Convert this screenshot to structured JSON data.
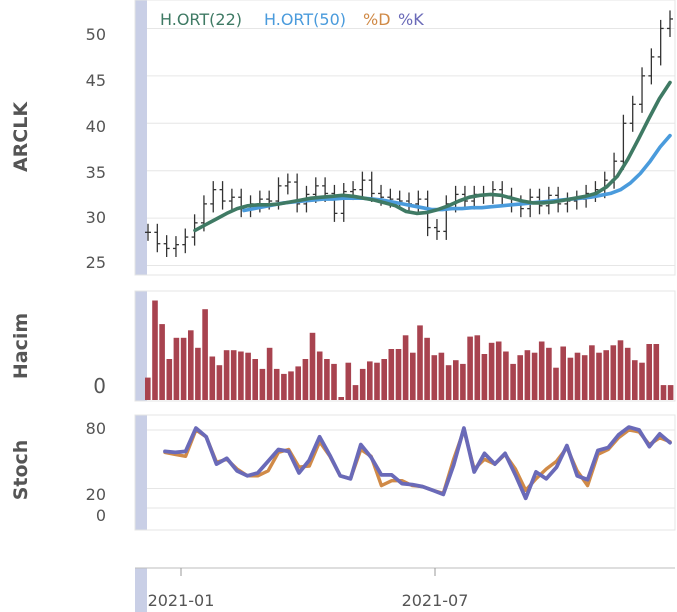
{
  "legend": {
    "ma22": {
      "label": "H.ORT(22)",
      "color": "#3f7a64"
    },
    "ma50": {
      "label": "H.ORT(50)",
      "color": "#4a9bdc"
    },
    "d": {
      "label": "%D",
      "color": "#d08a47"
    },
    "k": {
      "label": "%K",
      "color": "#6a6ab8"
    }
  },
  "chart_data": [
    {
      "type": "line",
      "panel": "price",
      "ylabel": "ARCLK",
      "ylim": [
        24,
        53
      ],
      "yticks": [
        25,
        30,
        35,
        40,
        45,
        50
      ],
      "grid": true,
      "legend_position": "top-left",
      "x_ticks": [
        "2021-01",
        "2021-07"
      ],
      "price_week_close": [
        28.5,
        27.3,
        26.8,
        27.2,
        28.0,
        29.5,
        31.5,
        33.0,
        31.8,
        32.2,
        31.0,
        31.5,
        32.0,
        31.8,
        33.4,
        33.8,
        31.5,
        32.5,
        33.4,
        32.6,
        30.5,
        32.8,
        33.0,
        34.0,
        32.6,
        32.2,
        32.0,
        31.8,
        31.5,
        32.0,
        29.0,
        28.6,
        31.5,
        32.5,
        31.8,
        32.5,
        32.4,
        33.0,
        32.3,
        31.5,
        31.0,
        32.2,
        31.3,
        32.4,
        31.5,
        31.8,
        32.0,
        32.6,
        33.0,
        34.0,
        36.0,
        40.0,
        42.0,
        45.0,
        47.0,
        50.0,
        51.0
      ],
      "series": [
        {
          "name": "H.ORT(22)",
          "values": [
            28.7,
            29.3,
            29.9,
            30.5,
            31.0,
            31.3,
            31.4,
            31.4,
            31.5,
            31.7,
            31.9,
            32.1,
            32.2,
            32.3,
            32.4,
            32.3,
            32.1,
            31.9,
            31.6,
            31.3,
            30.7,
            30.5,
            30.6,
            30.9,
            31.3,
            31.8,
            32.2,
            32.4,
            32.5,
            32.4,
            32.1,
            31.8,
            31.6,
            31.6,
            31.7,
            31.9,
            32.1,
            32.3,
            32.6,
            33.3,
            34.4,
            36.2,
            38.3,
            40.5,
            42.6,
            44.3
          ]
        },
        {
          "name": "H.ORT(50)",
          "values": [
            30.8,
            31.0,
            31.2,
            31.4,
            31.6,
            31.7,
            31.8,
            31.9,
            32.0,
            32.0,
            32.1,
            32.1,
            32.1,
            32.0,
            31.9,
            31.7,
            31.5,
            31.3,
            31.1,
            30.9,
            30.9,
            31.0,
            31.0,
            31.1,
            31.1,
            31.2,
            31.3,
            31.4,
            31.5,
            31.6,
            31.7,
            31.8,
            31.9,
            32.0,
            32.1,
            32.2,
            32.4,
            32.6,
            33.0,
            33.7,
            34.7,
            36.0,
            37.5,
            38.7
          ]
        }
      ]
    },
    {
      "type": "bar",
      "panel": "volume",
      "ylabel": "Hacim",
      "yticks": [
        0
      ],
      "values": [
        18,
        80,
        61,
        33,
        50,
        50,
        56,
        42,
        73,
        35,
        28,
        40,
        40,
        39,
        38,
        33,
        25,
        42,
        25,
        21,
        23,
        27,
        33,
        54,
        39,
        33,
        29,
        0,
        30,
        12,
        25,
        31,
        30,
        33,
        41,
        41,
        52,
        38,
        60,
        50,
        36,
        38,
        28,
        32,
        29,
        51,
        52,
        37,
        46,
        47,
        39,
        29,
        36,
        40,
        38,
        47,
        42,
        26,
        43,
        34,
        38,
        36,
        44,
        38,
        40,
        44,
        48,
        42,
        32,
        30,
        45,
        45,
        12,
        12
      ]
    },
    {
      "type": "line",
      "panel": "stochastic",
      "ylabel": "Stoch",
      "ylim": [
        -10,
        95
      ],
      "yticks": [
        0,
        20,
        80
      ],
      "series": [
        {
          "name": "%D",
          "values": [
            57,
            55,
            53,
            80,
            73,
            47,
            50,
            40,
            33,
            33,
            38,
            57,
            60,
            42,
            43,
            68,
            53,
            33,
            30,
            60,
            53,
            23,
            28,
            28,
            23,
            22,
            18,
            15,
            50,
            80,
            40,
            50,
            45,
            55,
            40,
            18,
            30,
            40,
            48,
            62,
            38,
            23,
            55,
            60,
            72,
            80,
            78,
            65,
            72,
            68
          ]
        },
        {
          "name": "%K",
          "values": [
            58,
            57,
            58,
            82,
            73,
            45,
            51,
            38,
            33,
            36,
            48,
            60,
            58,
            36,
            49,
            73,
            54,
            33,
            30,
            65,
            52,
            34,
            34,
            25,
            24,
            22,
            18,
            14,
            44,
            82,
            37,
            56,
            45,
            56,
            34,
            10,
            37,
            30,
            42,
            64,
            33,
            29,
            59,
            62,
            75,
            83,
            80,
            63,
            76,
            67
          ]
        }
      ]
    }
  ],
  "axis_labels": {
    "price_y": [
      "25",
      "30",
      "35",
      "40",
      "45",
      "50"
    ],
    "vol_y": [
      "0"
    ],
    "stoch_y": [
      "0",
      "20",
      "80"
    ]
  }
}
